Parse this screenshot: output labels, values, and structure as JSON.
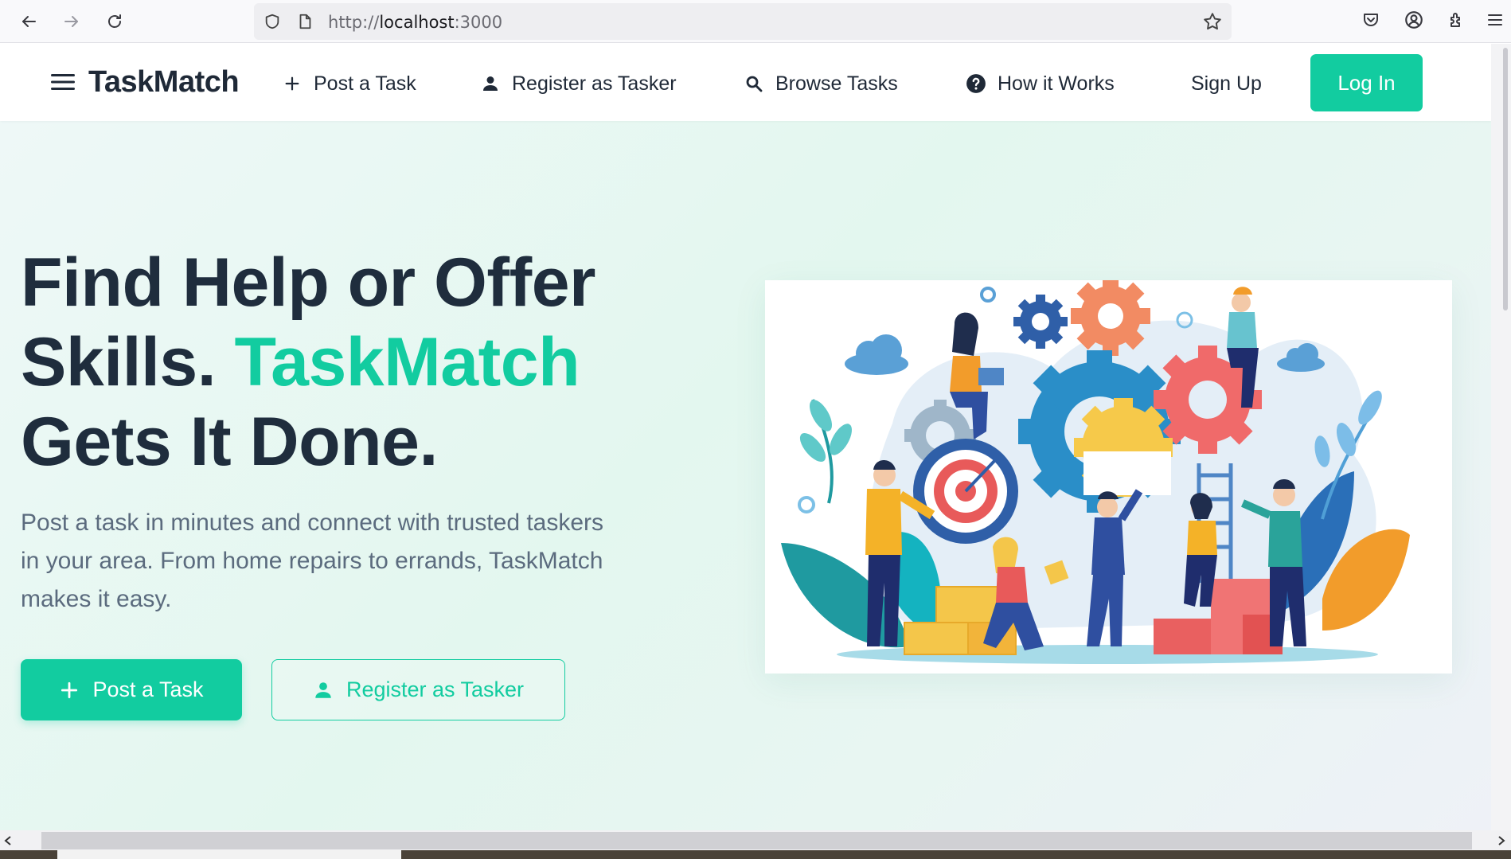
{
  "browser": {
    "url_scheme": "http://",
    "url_host": "localhost",
    "url_port": ":3000",
    "icons": [
      "back-arrow-icon",
      "forward-arrow-icon",
      "reload-icon",
      "shield-icon",
      "page-icon",
      "star-icon",
      "pocket-icon",
      "account-icon",
      "extensions-icon",
      "menu-icon"
    ]
  },
  "header": {
    "brand": "TaskMatch",
    "nav": {
      "post_task": "Post a Task",
      "register_tasker": "Register as Tasker",
      "browse_tasks": "Browse Tasks",
      "how_it_works": "How it Works",
      "sign_up": "Sign Up",
      "log_in": "Log In"
    }
  },
  "hero": {
    "title_line1": "Find Help or Offer",
    "title_line2_a": "Skills.",
    "title_line2_accent": "TaskMatch",
    "title_line3": "Gets It Done.",
    "subtitle": "Post a task in minutes and connect with trusted taskers in your area. From home repairs to errands, TaskMatch makes it easy.",
    "primary_cta": "Post a Task",
    "secondary_cta": "Register as Tasker"
  },
  "colors": {
    "accent": "#12cca0",
    "heading": "#1f2d3d",
    "body_text": "#5b6b7e"
  }
}
